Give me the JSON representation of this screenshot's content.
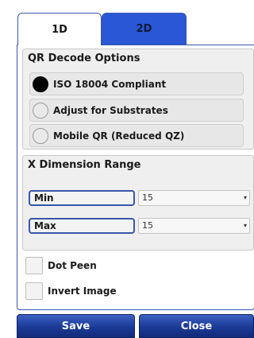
{
  "tabs": [
    {
      "label": "1D"
    },
    {
      "label": "2D"
    }
  ],
  "qr_options": {
    "title": "QR Decode Options",
    "items": [
      {
        "label": "ISO 18004 Compliant",
        "selected": true
      },
      {
        "label": "Adjust for Substrates",
        "selected": false
      },
      {
        "label": "Mobile QR (Reduced QZ)",
        "selected": false
      }
    ]
  },
  "x_dimension": {
    "title": "X Dimension Range",
    "min_label": "Min",
    "min_value": "15",
    "max_label": "Max",
    "max_value": "15"
  },
  "checkboxes": [
    {
      "label": "Dot Peen",
      "checked": false
    },
    {
      "label": "Invert Image",
      "checked": false
    }
  ],
  "buttons": {
    "save": "Save",
    "close": "Close"
  },
  "colors": {
    "accent": "#2a57d6",
    "button": "#1b3a96"
  }
}
